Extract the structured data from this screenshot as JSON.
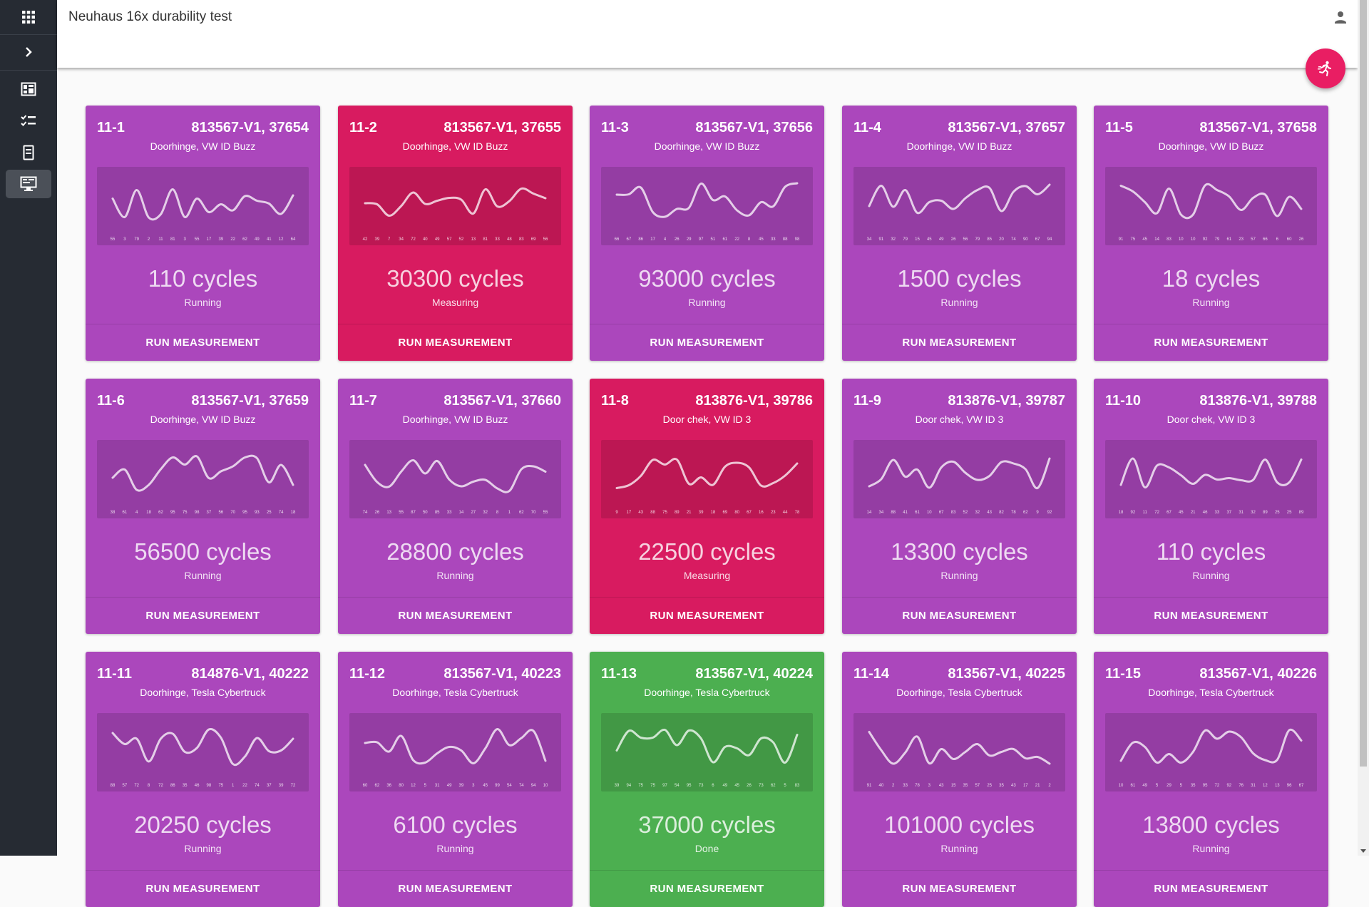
{
  "app": {
    "title": "Neuhaus 16x durability test"
  },
  "sidebar": {
    "items": [
      {
        "icon": "apps-grid-icon"
      },
      {
        "icon": "chevron-right-icon"
      },
      {
        "icon": "dashboard-icon"
      },
      {
        "icon": "checklist-icon"
      },
      {
        "icon": "document-icon"
      },
      {
        "icon": "monitor-icon",
        "active": true
      }
    ]
  },
  "header": {
    "user_icon": "person-icon"
  },
  "fab": {
    "icon": "running-person-icon"
  },
  "colors": {
    "running": "#ab47bc",
    "measuring": "#d81b60",
    "done": "#4caf50",
    "sidebar": "#262b33",
    "fab": "#e91e63"
  },
  "action_label": "RUN MEASUREMENT",
  "stations": [
    {
      "id": "11-1",
      "part": "813567-V1, 37654",
      "desc": "Doorhinge, VW ID Buzz",
      "cycles": "110 cycles",
      "status": "Running",
      "state": "running",
      "values": [
        55,
        3,
        79,
        2,
        11,
        81,
        3,
        55,
        17,
        39,
        22,
        62,
        49,
        41,
        12,
        64
      ]
    },
    {
      "id": "11-2",
      "part": "813567-V1, 37655",
      "desc": "Doorhinge, VW ID Buzz",
      "cycles": "30300 cycles",
      "status": "Measuring",
      "state": "measuring",
      "values": [
        42,
        39,
        7,
        34,
        72,
        40,
        49,
        57,
        52,
        13,
        81,
        33,
        48,
        83,
        69,
        56
      ]
    },
    {
      "id": "11-3",
      "part": "813567-V1, 37656",
      "desc": "Doorhinge, VW ID Buzz",
      "cycles": "93000 cycles",
      "status": "Running",
      "state": "running",
      "values": [
        66,
        67,
        86,
        17,
        4,
        26,
        29,
        97,
        51,
        61,
        22,
        8,
        45,
        33,
        88,
        98
      ]
    },
    {
      "id": "11-4",
      "part": "813567-V1, 37657",
      "desc": "Doorhinge, VW ID Buzz",
      "cycles": "1500 cycles",
      "status": "Running",
      "state": "running",
      "values": [
        34,
        91,
        32,
        79,
        15,
        45,
        49,
        26,
        56,
        79,
        85,
        20,
        74,
        90,
        67,
        94
      ]
    },
    {
      "id": "11-5",
      "part": "813567-V1, 37658",
      "desc": "Doorhinge, VW ID Buzz",
      "cycles": "18 cycles",
      "status": "Running",
      "state": "running",
      "values": [
        91,
        75,
        45,
        14,
        83,
        10,
        10,
        92,
        79,
        61,
        23,
        57,
        66,
        6,
        60,
        26
      ]
    },
    {
      "id": "11-6",
      "part": "813567-V1, 37659",
      "desc": "Doorhinge, VW ID Buzz",
      "cycles": "56500 cycles",
      "status": "Running",
      "state": "running",
      "values": [
        38,
        61,
        4,
        18,
        62,
        95,
        75,
        98,
        37,
        56,
        70,
        95,
        93,
        25,
        74,
        18
      ]
    },
    {
      "id": "11-7",
      "part": "813567-V1, 37660",
      "desc": "Doorhinge, VW ID Buzz",
      "cycles": "28800 cycles",
      "status": "Running",
      "state": "running",
      "values": [
        74,
        26,
        13,
        55,
        87,
        50,
        85,
        33,
        14,
        27,
        32,
        8,
        1,
        62,
        70,
        55
      ]
    },
    {
      "id": "11-8",
      "part": "813876-V1, 39786",
      "desc": "Door chek, VW ID 3",
      "cycles": "22500 cycles",
      "status": "Measuring",
      "state": "measuring",
      "values": [
        9,
        17,
        43,
        88,
        75,
        89,
        21,
        39,
        18,
        69,
        80,
        67,
        16,
        23,
        44,
        78
      ]
    },
    {
      "id": "11-9",
      "part": "813876-V1, 39787",
      "desc": "Door chek, VW ID 3",
      "cycles": "13300 cycles",
      "status": "Running",
      "state": "running",
      "values": [
        14,
        34,
        88,
        41,
        61,
        10,
        67,
        83,
        52,
        32,
        43,
        82,
        78,
        62,
        9,
        92
      ]
    },
    {
      "id": "11-10",
      "part": "813876-V1, 39788",
      "desc": "Door chek, VW ID 3",
      "cycles": "110 cycles",
      "status": "Running",
      "state": "running",
      "values": [
        18,
        92,
        11,
        72,
        67,
        45,
        21,
        46,
        33,
        37,
        31,
        32,
        89,
        25,
        25,
        89
      ]
    },
    {
      "id": "11-11",
      "part": "814876-V1, 40222",
      "desc": "Doorhinge, Tesla Cybertruck",
      "cycles": "20250 cycles",
      "status": "Running",
      "state": "running",
      "values": [
        88,
        57,
        72,
        8,
        72,
        86,
        35,
        46,
        98,
        75,
        1,
        22,
        74,
        37,
        39,
        72
      ]
    },
    {
      "id": "11-12",
      "part": "813567-V1, 40223",
      "desc": "Doorhinge, Tesla Cybertruck",
      "cycles": "6100 cycles",
      "status": "Running",
      "state": "running",
      "values": [
        60,
        62,
        36,
        80,
        12,
        5,
        31,
        49,
        39,
        3,
        45,
        99,
        54,
        74,
        94,
        10
      ]
    },
    {
      "id": "11-13",
      "part": "813567-V1, 40224",
      "desc": "Doorhinge, Tesla Cybertruck",
      "cycles": "37000 cycles",
      "status": "Done",
      "state": "done",
      "values": [
        39,
        94,
        75,
        75,
        97,
        54,
        95,
        73,
        6,
        49,
        45,
        26,
        73,
        62,
        5,
        83
      ]
    },
    {
      "id": "11-14",
      "part": "813567-V1, 40225",
      "desc": "Doorhinge, Tesla Cybertruck",
      "cycles": "101000 cycles",
      "status": "Running",
      "state": "running",
      "values": [
        91,
        40,
        2,
        33,
        78,
        3,
        43,
        15,
        35,
        57,
        25,
        35,
        43,
        17,
        21,
        2
      ]
    },
    {
      "id": "11-15",
      "part": "813567-V1, 40226",
      "desc": "Doorhinge, Tesla Cybertruck",
      "cycles": "13800 cycles",
      "status": "Running",
      "state": "running",
      "values": [
        10,
        61,
        49,
        5,
        29,
        5,
        35,
        95,
        72,
        92,
        76,
        31,
        12,
        13,
        96,
        67
      ]
    }
  ]
}
